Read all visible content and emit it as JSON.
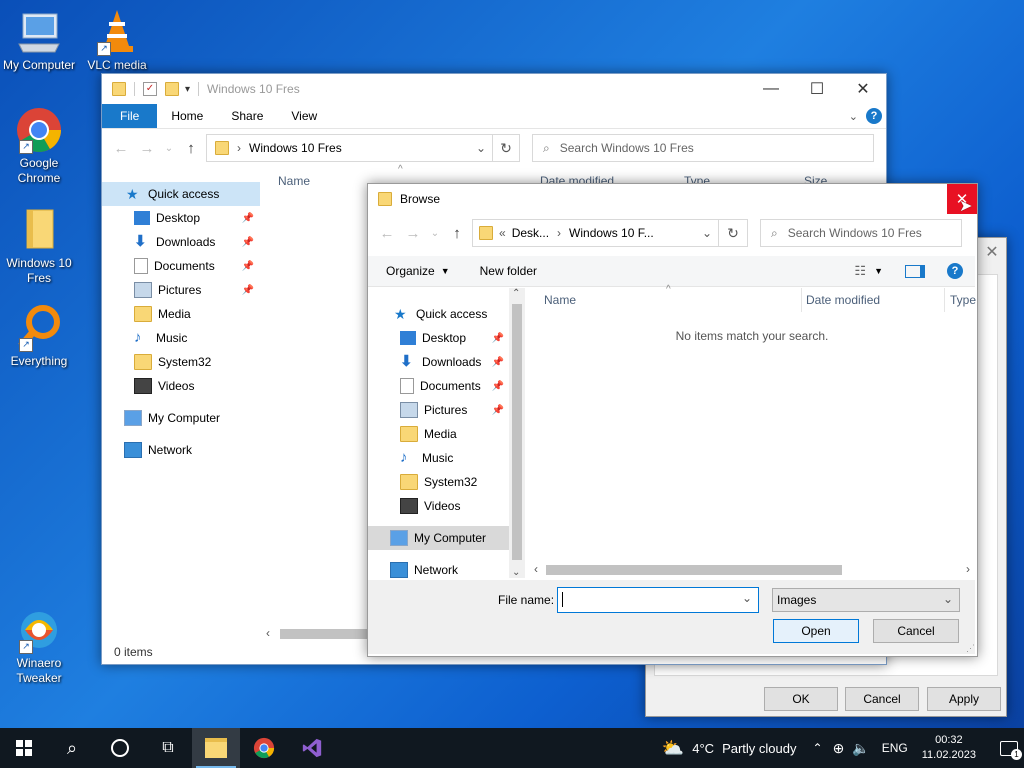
{
  "desktop": {
    "icons": [
      {
        "label": "My Computer",
        "icon": "my-computer-icon"
      },
      {
        "label": "VLC media",
        "icon": "vlc-cone-icon"
      },
      {
        "label": "Google Chrome",
        "icon": "chrome-icon"
      },
      {
        "label": "Windows 10 Fres",
        "icon": "folder-icon"
      },
      {
        "label": "Everything",
        "icon": "everything-search-icon"
      },
      {
        "label": "Winaero Tweaker",
        "icon": "winaero-icon"
      }
    ]
  },
  "explorer": {
    "title": "Windows 10 Fres",
    "tabs": {
      "file": "File",
      "home": "Home",
      "share": "Share",
      "view": "View"
    },
    "address": "Windows 10 Fres",
    "search_placeholder": "Search Windows 10 Fres",
    "columns": {
      "name": "Name",
      "date": "Date modified",
      "type": "Type",
      "size": "Size"
    },
    "nav": {
      "quick_access": "Quick access",
      "items": [
        "Desktop",
        "Downloads",
        "Documents",
        "Pictures",
        "Media",
        "Music",
        "System32",
        "Videos"
      ],
      "my_computer": "My Computer",
      "network": "Network"
    },
    "status": "0 items"
  },
  "browse": {
    "title": "Browse",
    "breadcrumb": {
      "prefix": "«",
      "part1": "Desk...",
      "part2": "Windows 10 F..."
    },
    "search_placeholder": "Search Windows 10 Fres",
    "toolbar": {
      "organize": "Organize",
      "new_folder": "New folder"
    },
    "columns": {
      "name": "Name",
      "date": "Date modified",
      "type": "Type"
    },
    "empty_message": "No items match your search.",
    "nav": {
      "quick_access": "Quick access",
      "items": [
        "Desktop",
        "Downloads",
        "Documents",
        "Pictures",
        "Media",
        "Music",
        "System32",
        "Videos"
      ],
      "my_computer": "My Computer",
      "network": "Network"
    },
    "file_name_label": "File name:",
    "file_name_value": "",
    "file_type": "Images",
    "open": "Open",
    "cancel": "Cancel"
  },
  "props_dialog": {
    "ok": "OK",
    "cancel": "Cancel",
    "apply": "Apply"
  },
  "taskbar": {
    "weather": "4°C",
    "weather_desc": "Partly cloudy",
    "lang": "ENG",
    "time": "00:32",
    "date": "11.02.2023",
    "notifications": "1"
  }
}
